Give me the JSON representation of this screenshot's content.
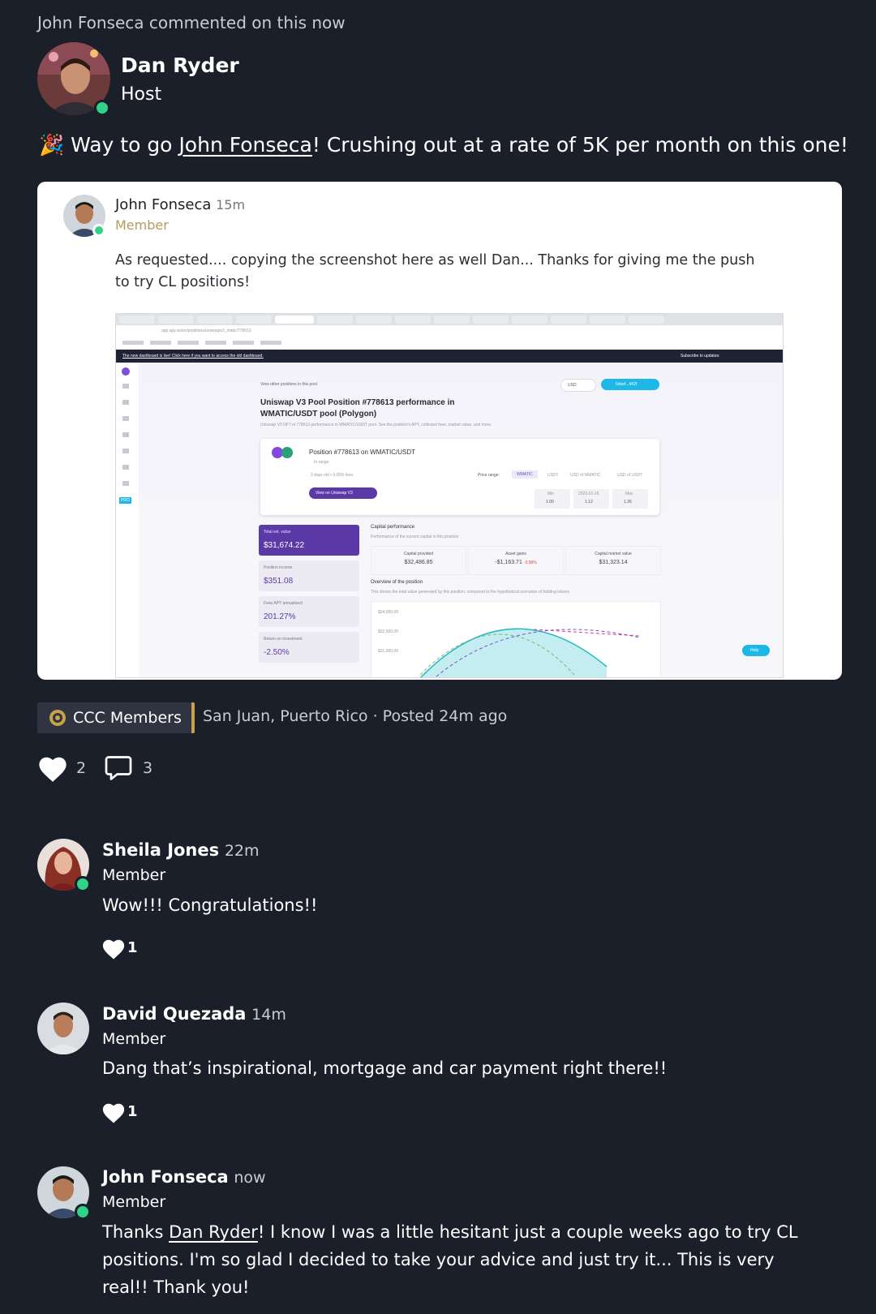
{
  "activity": "John Fonseca commented on this now",
  "post": {
    "author": "Dan Ryder",
    "role": "Host",
    "emoji": "🎉",
    "text_before": " Way to go ",
    "mention": "John Fonseca",
    "text_after": "! Crushing out at a rate of 5K per month on this one!",
    "embed": {
      "author": "John Fonseca",
      "time": "15m",
      "role": "Member",
      "text": "As requested.... copying the screenshot here as well Dan... Thanks for giving me the push to try CL positions!",
      "screenshot": {
        "url": "app.apy.vision/positions/uniswapv3_matic/778613",
        "banner_link": "The new dashboard is live! Click here if you want to access the old dashboard.",
        "subscribe": "Subscribe to updates:",
        "back_link": "View other positions in this pool",
        "currency": "USD",
        "wallet": "0xbef...442f",
        "title_line1": "Uniswap V3 Pool Position #778613 performance in",
        "title_line2": "WMATIC/USDT pool (Polygon)",
        "subtitle": "Uniswap V3 NFT id 778613 performance in WMATIC/USDT pool. See the position's APY, collected fees, market value, and more.",
        "position_title": "Position #778613 on WMATIC/USDT",
        "in_range": "In range",
        "position_meta": "2 days old • 0.05% fees",
        "price_range_label": "Price range:",
        "range_tabs": [
          "WMATIC",
          "USDT",
          "USD of WMATIC",
          "USD of USDT"
        ],
        "view_button": "View on Uniswap V3",
        "range_boxes": [
          {
            "label": "Min",
            "value": "1.00"
          },
          {
            "label": "2023-01-15",
            "value": "1.12"
          },
          {
            "label": "Max",
            "value": "1.35"
          }
        ],
        "stats": [
          {
            "label": "Total est. value",
            "value": "$31,674.22"
          },
          {
            "label": "Position income",
            "value": "$351.08"
          },
          {
            "label": "Fees APY annualized",
            "value": "201.27%"
          },
          {
            "label": "Return on investment",
            "value": "-2.50%"
          }
        ],
        "capital_title": "Capital performance",
        "capital_sub": "Performance of the current capital in this position",
        "capital": [
          {
            "label": "Capital provided",
            "value": "$32,486.85"
          },
          {
            "label": "Asset gains",
            "value": "-$1,163.71"
          },
          {
            "label": "Capital market value",
            "value": "$31,323.14"
          }
        ],
        "asset_gains_pct": "-3.58%",
        "overview_title": "Overview of the position",
        "overview_sub": "This shows the total value generated by this position, compared to the hypothetical scenarios of holding tokens",
        "chart_ticks": [
          "$34,000.00",
          "$32,500.00",
          "$31,000.00"
        ],
        "help": "Help",
        "pro": "PRO"
      }
    },
    "group": "CCC Members",
    "location": "San Juan, Puerto Rico",
    "separator": "·",
    "posted": "Posted 24m ago",
    "likes": "2",
    "comments": "3"
  },
  "comments": [
    {
      "author": "Sheila Jones",
      "time": "22m",
      "role": "Member",
      "text": "Wow!!! Congratulations!!",
      "likes": "1"
    },
    {
      "author": "David Quezada",
      "time": "14m",
      "role": "Member",
      "text": "Dang that’s inspirational, mortgage and car payment right there!!",
      "likes": "1"
    },
    {
      "author": "John Fonseca",
      "time": "now",
      "role": "Member",
      "text_before": "Thanks ",
      "mention": "Dan Ryder",
      "text_after": "! I know I was a little hesitant just a couple weeks ago to try CL positions. I'm so glad I decided to take your advice and just try it... This is very real!! Thank you!"
    }
  ],
  "colors": {
    "background": "#1b1f2a",
    "online": "#2fd286",
    "member_gold": "#b89a5a",
    "tag_border": "#c8a24a",
    "accent_purple": "#5b3aa8",
    "accent_cyan": "#1eb8e8"
  },
  "icons": [
    "heart-icon",
    "comment-icon",
    "party-popper-icon",
    "group-badge-icon"
  ]
}
